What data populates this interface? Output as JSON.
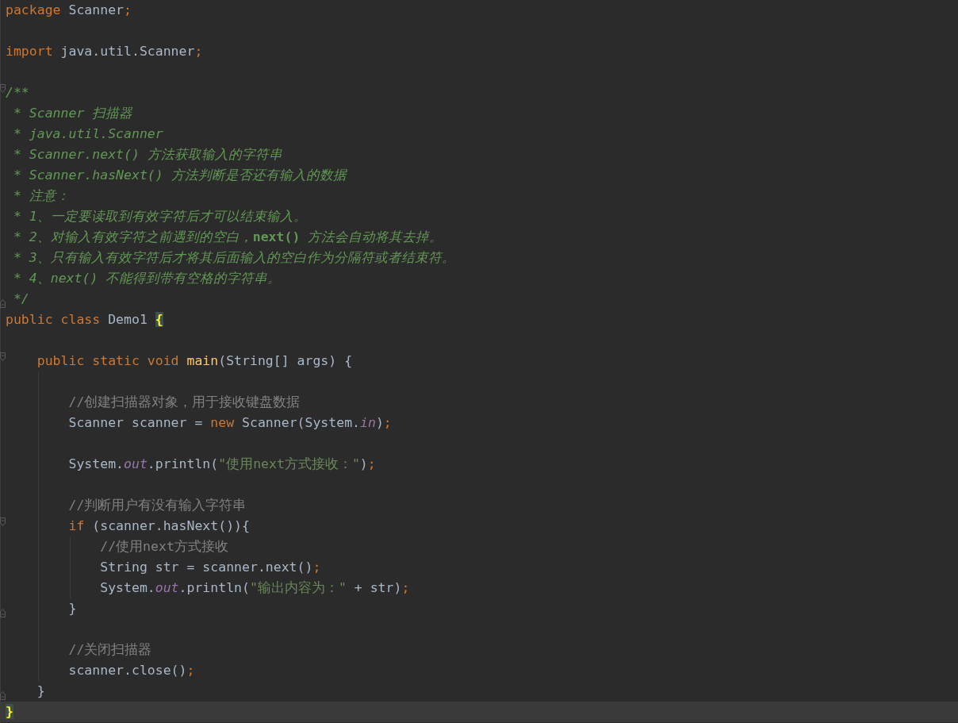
{
  "editor": {
    "blocks": [
      {
        "lines": [
          {
            "tokens": [
              {
                "kind": "keyword",
                "text": "package "
              },
              {
                "kind": "plain",
                "text": "Scanner"
              },
              {
                "kind": "punct",
                "text": ";"
              }
            ]
          }
        ]
      },
      {
        "lines": [
          {
            "tokens": [
              {
                "kind": "keyword",
                "text": "import "
              },
              {
                "kind": "plain",
                "text": "java.util.Scanner"
              },
              {
                "kind": "punct",
                "text": ";"
              }
            ]
          }
        ]
      },
      {
        "lines": [
          {
            "fold_start": true,
            "tokens": [
              {
                "kind": "doc",
                "text": "/**"
              }
            ]
          },
          {
            "tokens": [
              {
                "kind": "doc",
                "text": " * Scanner 扫描器"
              }
            ]
          },
          {
            "tokens": [
              {
                "kind": "doc",
                "text": " * java.util.Scanner"
              }
            ]
          },
          {
            "tokens": [
              {
                "kind": "doc",
                "text": " * Scanner.next() 方法获取输入的字符串"
              }
            ]
          },
          {
            "tokens": [
              {
                "kind": "doc",
                "text": " * Scanner.hasNext() 方法判断是否还有输入的数据"
              }
            ]
          },
          {
            "tokens": [
              {
                "kind": "doc",
                "text": " * 注意："
              }
            ]
          },
          {
            "tokens": [
              {
                "kind": "doc",
                "text": " * 1、一定要读取到有效字符后才可以结束输入。"
              }
            ]
          },
          {
            "tokens": [
              {
                "kind": "doc",
                "text": " * 2、对输入有效字符之前遇到的空白，"
              },
              {
                "kind": "doc-code",
                "text": "next()"
              },
              {
                "kind": "doc",
                "text": " 方法会自动将其去掉。"
              }
            ]
          },
          {
            "tokens": [
              {
                "kind": "doc",
                "text": " * 3、只有输入有效字符后才将其后面输入的空白作为分隔符或者结束符。"
              }
            ]
          },
          {
            "tokens": [
              {
                "kind": "doc",
                "text": " * 4、next() 不能得到带有空格的字符串。"
              }
            ]
          },
          {
            "fold_end": true,
            "tokens": [
              {
                "kind": "doc",
                "text": " */"
              }
            ]
          },
          {
            "tokens": [
              {
                "kind": "keyword",
                "text": "public class "
              },
              {
                "kind": "plain",
                "text": "Demo1 "
              },
              {
                "kind": "brace-match",
                "text": "{"
              }
            ]
          }
        ]
      },
      {
        "lines": [
          {
            "fold_start": true,
            "tokens": [
              {
                "kind": "keyword",
                "text": "    public static void "
              },
              {
                "kind": "method",
                "text": "main"
              },
              {
                "kind": "plain",
                "text": "(String[] args) {"
              }
            ]
          }
        ]
      },
      {
        "lines": [
          {
            "tokens": [
              {
                "kind": "comment",
                "text": "        //创建扫描器对象，用于接收键盘数据"
              }
            ]
          },
          {
            "tokens": [
              {
                "kind": "plain",
                "text": "        Scanner scanner = "
              },
              {
                "kind": "keyword",
                "text": "new "
              },
              {
                "kind": "plain",
                "text": "Scanner(System."
              },
              {
                "kind": "field",
                "text": "in"
              },
              {
                "kind": "plain",
                "text": ")"
              },
              {
                "kind": "punct",
                "text": ";"
              }
            ]
          }
        ]
      },
      {
        "lines": [
          {
            "tokens": [
              {
                "kind": "plain",
                "text": "        System."
              },
              {
                "kind": "field",
                "text": "out"
              },
              {
                "kind": "plain",
                "text": ".println("
              },
              {
                "kind": "string",
                "text": "\"使用next方式接收：\""
              },
              {
                "kind": "plain",
                "text": ")"
              },
              {
                "kind": "punct",
                "text": ";"
              }
            ]
          }
        ]
      },
      {
        "lines": [
          {
            "tokens": [
              {
                "kind": "comment",
                "text": "        //判断用户有没有输入字符串"
              }
            ]
          },
          {
            "fold_start": true,
            "tokens": [
              {
                "kind": "keyword",
                "text": "        if "
              },
              {
                "kind": "plain",
                "text": "(scanner.hasNext()){"
              }
            ]
          },
          {
            "tokens": [
              {
                "kind": "comment",
                "text": "            //使用next方式接收"
              }
            ]
          },
          {
            "tokens": [
              {
                "kind": "plain",
                "text": "            String str = scanner.next()"
              },
              {
                "kind": "punct",
                "text": ";"
              }
            ]
          },
          {
            "tokens": [
              {
                "kind": "plain",
                "text": "            System."
              },
              {
                "kind": "field",
                "text": "out"
              },
              {
                "kind": "plain",
                "text": ".println("
              },
              {
                "kind": "string",
                "text": "\"输出内容为：\""
              },
              {
                "kind": "plain",
                "text": " + str)"
              },
              {
                "kind": "punct",
                "text": ";"
              }
            ]
          },
          {
            "fold_end": true,
            "tokens": [
              {
                "kind": "plain",
                "text": "        }"
              }
            ]
          }
        ]
      },
      {
        "lines": [
          {
            "tokens": [
              {
                "kind": "comment",
                "text": "        //关闭扫描器"
              }
            ]
          },
          {
            "tokens": [
              {
                "kind": "plain",
                "text": "        scanner.close()"
              },
              {
                "kind": "punct",
                "text": ";"
              }
            ]
          },
          {
            "fold_end": true,
            "tokens": [
              {
                "kind": "plain",
                "text": "    }"
              }
            ]
          },
          {
            "current": true,
            "tokens": [
              {
                "kind": "brace-match",
                "text": "}"
              }
            ]
          }
        ]
      }
    ]
  }
}
